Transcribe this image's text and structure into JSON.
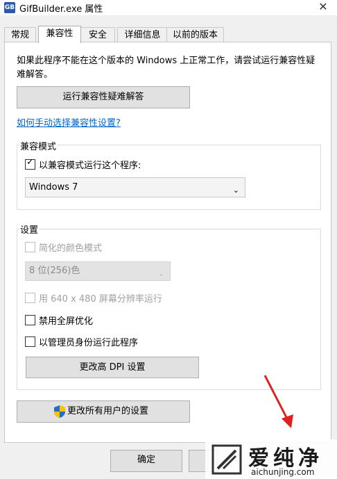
{
  "window": {
    "title": "GifBuilder.exe 属性",
    "close_glyph": "✕"
  },
  "tabs": [
    {
      "label": "常规",
      "active": false
    },
    {
      "label": "兼容性",
      "active": true
    },
    {
      "label": "安全",
      "active": false
    },
    {
      "label": "详细信息",
      "active": false
    },
    {
      "label": "以前的版本",
      "active": false
    }
  ],
  "compat": {
    "description": "如果此程序不能在这个版本的 Windows 上正常工作，请尝试运行兼容性疑难解答。",
    "troubleshoot_button": "运行兼容性疑难解答",
    "manual_link": "如何手动选择兼容性设置?"
  },
  "mode_group": {
    "label": "兼容模式",
    "checkbox_label": "以兼容模式运行这个程序:",
    "checked": true,
    "os_value": "Windows 7"
  },
  "settings_group": {
    "label": "设置",
    "reduced_color_label": "简化的颜色模式",
    "color_depth_value": "8 位(256)色",
    "low_res_label": "用 640 x 480 屏幕分辨率运行",
    "disable_fullscreen_label": "禁用全屏优化",
    "run_as_admin_label": "以管理员身份运行此程序",
    "dpi_button": "更改高 DPI 设置"
  },
  "all_users_button": "更改所有用户的设置",
  "footer": {
    "ok_label": "确定"
  },
  "watermark": {
    "text": "爱纯净",
    "url": "aichunjing.com"
  },
  "colors": {
    "link": "#0066cc",
    "annotation_arrow": "#e02020",
    "shield_blue": "#2a6ac9",
    "shield_yellow": "#f2c500"
  },
  "icons": {
    "app": "app-icon",
    "close": "close-icon",
    "chevron": "chevron-down-icon",
    "shield": "uac-shield-icon"
  }
}
